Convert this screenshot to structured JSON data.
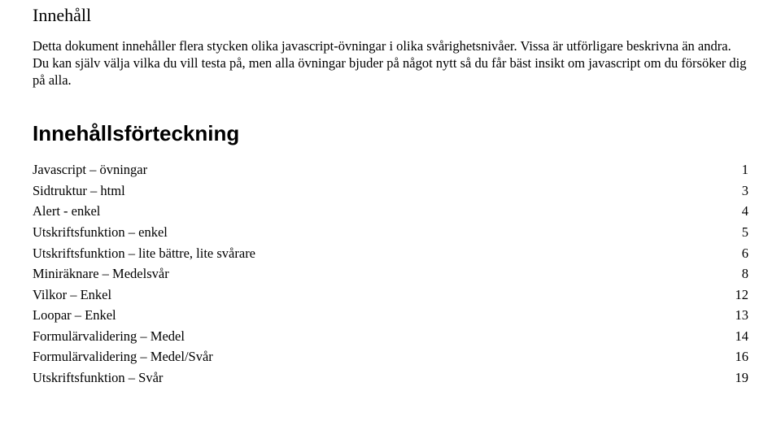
{
  "heading": "Innehåll",
  "intro": "Detta dokument innehåller flera stycken olika javascript-övningar i olika svårighetsnivåer. Vissa är utförligare beskrivna än andra. Du kan själv välja vilka du vill testa på, men alla övningar bjuder på något nytt så du får bäst insikt om javascript om du försöker dig på alla.",
  "toc_heading": "Innehållsförteckning",
  "toc": [
    {
      "label": "Javascript – övningar",
      "page": "1"
    },
    {
      "label": "Sidtruktur – html",
      "page": "3"
    },
    {
      "label": "Alert - enkel",
      "page": "4"
    },
    {
      "label": "Utskriftsfunktion – enkel",
      "page": "5"
    },
    {
      "label": "Utskriftsfunktion – lite bättre, lite svårare",
      "page": "6"
    },
    {
      "label": "Miniräknare – Medelsvår",
      "page": "8"
    },
    {
      "label": "Vilkor – Enkel",
      "page": "12"
    },
    {
      "label": "Loopar – Enkel",
      "page": "13"
    },
    {
      "label": "Formulärvalidering – Medel",
      "page": "14"
    },
    {
      "label": "Formulärvalidering – Medel/Svår",
      "page": "16"
    },
    {
      "label": "Utskriftsfunktion – Svår",
      "page": "19"
    }
  ]
}
